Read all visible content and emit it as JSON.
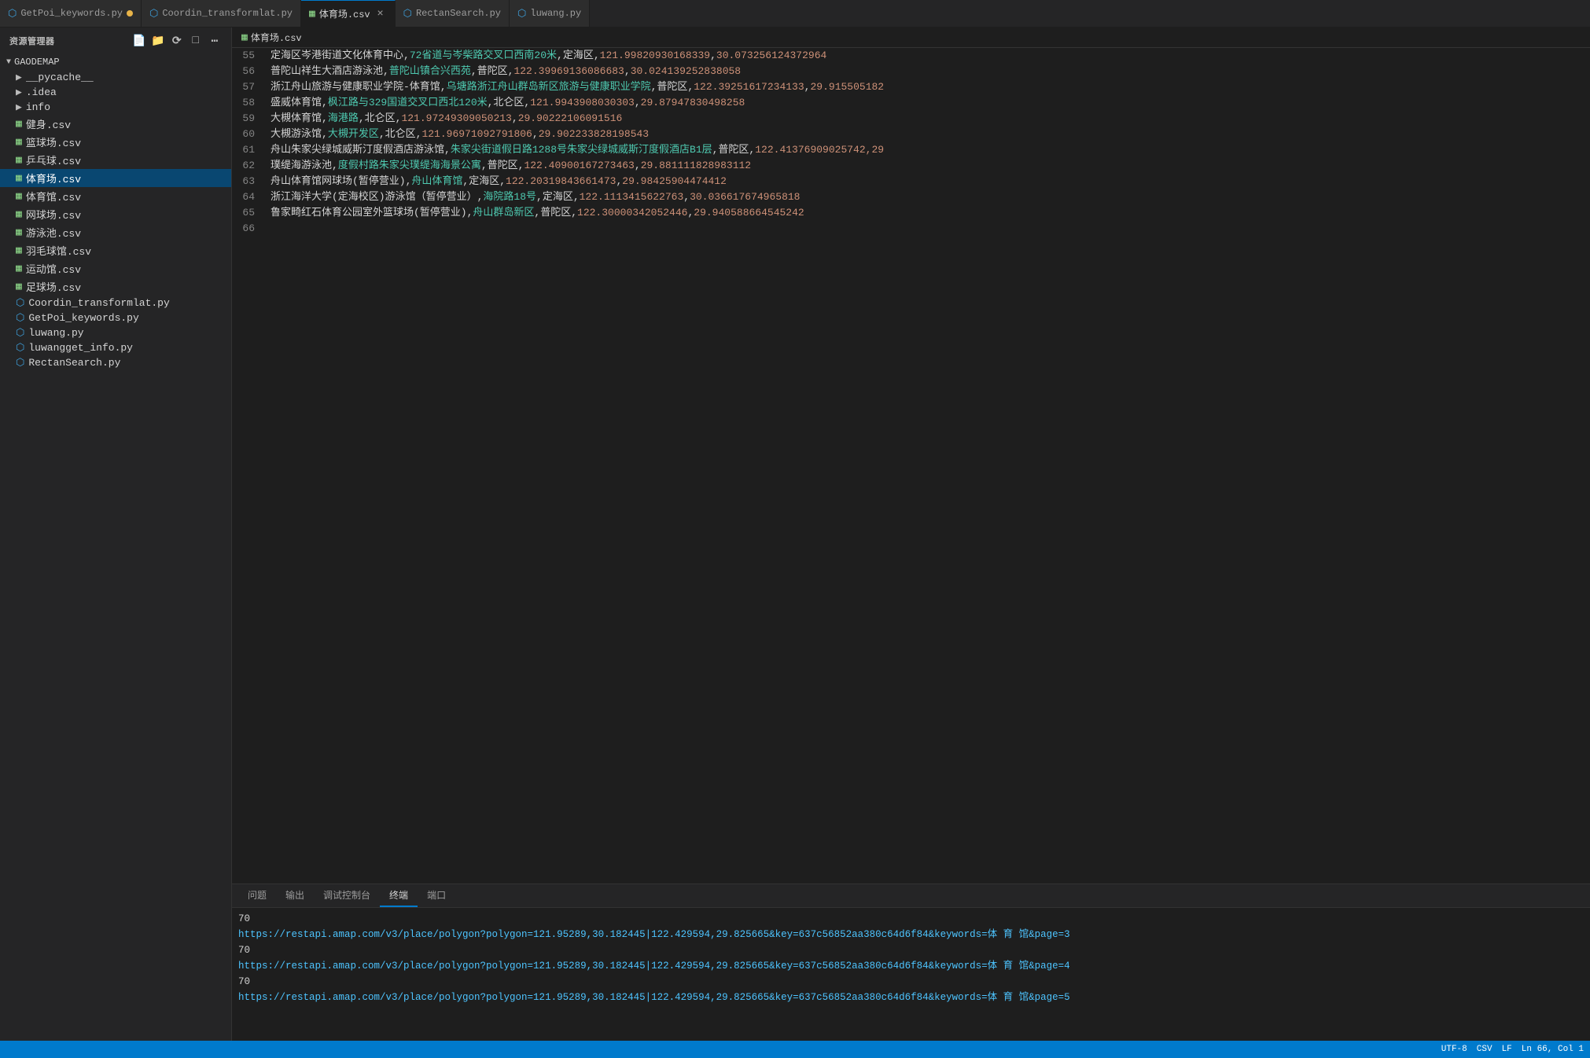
{
  "app": {
    "title": "资源管理器",
    "more_icon": "⋯"
  },
  "tabs": [
    {
      "id": "tab-getpoi",
      "label": "GetPoi_keywords.py",
      "icon_type": "py",
      "active": false,
      "modified": true,
      "closable": false
    },
    {
      "id": "tab-coordin",
      "label": "Coordin_transformlat.py",
      "icon_type": "py",
      "active": false,
      "modified": false,
      "closable": false
    },
    {
      "id": "tab-tiyuchang",
      "label": "体育场.csv",
      "icon_type": "csv",
      "active": true,
      "modified": false,
      "closable": true
    },
    {
      "id": "tab-rectansearch",
      "label": "RectanSearch.py",
      "icon_type": "py",
      "active": false,
      "modified": false,
      "closable": false
    },
    {
      "id": "tab-luwang",
      "label": "luwang.py",
      "icon_type": "py",
      "active": false,
      "modified": false,
      "closable": false
    }
  ],
  "breadcrumb": {
    "icon_type": "csv",
    "path": "体育场.csv"
  },
  "sidebar": {
    "title": "资源管理器",
    "root": "GAODEMAP",
    "items": [
      {
        "id": "pycache",
        "label": "__pycache__",
        "type": "folder",
        "indent": 1
      },
      {
        "id": "idea",
        "label": ".idea",
        "type": "folder",
        "indent": 1
      },
      {
        "id": "info",
        "label": "info",
        "type": "folder",
        "indent": 1
      },
      {
        "id": "jianshen",
        "label": "健身.csv",
        "type": "csv",
        "indent": 1,
        "active": false
      },
      {
        "id": "lanqiuchang",
        "label": "篮球场.csv",
        "type": "csv",
        "indent": 1,
        "active": false
      },
      {
        "id": "pingpangqiu",
        "label": "乒乓球.csv",
        "type": "csv",
        "indent": 1,
        "active": false
      },
      {
        "id": "tiyuchang",
        "label": "体育场.csv",
        "type": "csv",
        "indent": 1,
        "active": true
      },
      {
        "id": "tiyuguan",
        "label": "体育馆.csv",
        "type": "csv",
        "indent": 1,
        "active": false
      },
      {
        "id": "wangqiuchang",
        "label": "网球场.csv",
        "type": "csv",
        "indent": 1,
        "active": false
      },
      {
        "id": "youyongchi",
        "label": "游泳池.csv",
        "type": "csv",
        "indent": 1,
        "active": false
      },
      {
        "id": "yumaoqiuguan",
        "label": "羽毛球馆.csv",
        "type": "csv",
        "indent": 1,
        "active": false
      },
      {
        "id": "yundongguan",
        "label": "运动馆.csv",
        "type": "csv",
        "indent": 1,
        "active": false
      },
      {
        "id": "zuqiuchang",
        "label": "足球场.csv",
        "type": "csv",
        "indent": 1,
        "active": false
      },
      {
        "id": "coordin",
        "label": "Coordin_transformlat.py",
        "type": "py",
        "indent": 1,
        "active": false
      },
      {
        "id": "getpoi",
        "label": "GetPoi_keywords.py",
        "type": "py",
        "indent": 1,
        "active": false
      },
      {
        "id": "luwang",
        "label": "luwang.py",
        "type": "py",
        "indent": 1,
        "active": false
      },
      {
        "id": "luwangget",
        "label": "luwangget_info.py",
        "type": "py",
        "indent": 1,
        "active": false
      },
      {
        "id": "rectansearch",
        "label": "RectanSearch.py",
        "type": "py",
        "indent": 1,
        "active": false
      }
    ]
  },
  "code_lines": [
    {
      "num": 55,
      "parts": [
        {
          "text": "定海区岑港街道文化体育中心,",
          "color": "white"
        },
        {
          "text": "72省道与岑柴路交叉口西南20米",
          "color": "green"
        },
        {
          "text": ",定海区,",
          "color": "white"
        },
        {
          "text": "121.99820930168339",
          "color": "orange"
        },
        {
          "text": ",",
          "color": "white"
        },
        {
          "text": "30.073256124372964",
          "color": "orange"
        }
      ]
    },
    {
      "num": 56,
      "parts": [
        {
          "text": "普陀山祥生大酒店游泳池,",
          "color": "white"
        },
        {
          "text": "普陀山镇合兴西苑",
          "color": "green"
        },
        {
          "text": ",普陀区,",
          "color": "white"
        },
        {
          "text": "122.39969136086683",
          "color": "orange"
        },
        {
          "text": ",",
          "color": "white"
        },
        {
          "text": "30.024139252838058",
          "color": "orange"
        }
      ]
    },
    {
      "num": 57,
      "parts": [
        {
          "text": "浙江舟山旅游与健康职业学院-体育馆,",
          "color": "white"
        },
        {
          "text": "乌塘路浙江舟山群岛新区旅游与健康职业学院",
          "color": "green"
        },
        {
          "text": ",普陀区,",
          "color": "white"
        },
        {
          "text": "122.39251617234133",
          "color": "orange"
        },
        {
          "text": ",",
          "color": "white"
        },
        {
          "text": "29.915505182",
          "color": "orange"
        }
      ]
    },
    {
      "num": 58,
      "parts": [
        {
          "text": "盛威体育馆,",
          "color": "white"
        },
        {
          "text": "枫江路与329国道交叉口西北120米",
          "color": "green"
        },
        {
          "text": ",北仑区,",
          "color": "white"
        },
        {
          "text": "121.9943908030303",
          "color": "orange"
        },
        {
          "text": ",",
          "color": "white"
        },
        {
          "text": "29.87947830498258",
          "color": "orange"
        }
      ]
    },
    {
      "num": 59,
      "parts": [
        {
          "text": "大槻体育馆,",
          "color": "white"
        },
        {
          "text": "海港路",
          "color": "green"
        },
        {
          "text": ",北仑区,",
          "color": "white"
        },
        {
          "text": "121.97249309050213",
          "color": "orange"
        },
        {
          "text": ",",
          "color": "white"
        },
        {
          "text": "29.90222106091516",
          "color": "orange"
        }
      ]
    },
    {
      "num": 60,
      "parts": [
        {
          "text": "大槻游泳馆,",
          "color": "white"
        },
        {
          "text": "大槻开发区",
          "color": "green"
        },
        {
          "text": ",北仑区,",
          "color": "white"
        },
        {
          "text": "121.96971092791806",
          "color": "orange"
        },
        {
          "text": ",",
          "color": "white"
        },
        {
          "text": "29.902233828198543",
          "color": "orange"
        }
      ]
    },
    {
      "num": 61,
      "parts": [
        {
          "text": "舟山朱家尖绿城威斯汀度假酒店游泳馆,",
          "color": "white"
        },
        {
          "text": "朱家尖街道假日路1288号朱家尖绿城威斯汀度假酒店B1层",
          "color": "green"
        },
        {
          "text": ",普陀区,",
          "color": "white"
        },
        {
          "text": "122.41376909025742",
          "color": "orange"
        },
        {
          "text": ",29",
          "color": "orange"
        }
      ]
    },
    {
      "num": 62,
      "parts": [
        {
          "text": "璞缇海游泳池,",
          "color": "white"
        },
        {
          "text": "度假村路朱家尖璞缇海海景公寓",
          "color": "green"
        },
        {
          "text": ",普陀区,",
          "color": "white"
        },
        {
          "text": "122.40900167273463",
          "color": "orange"
        },
        {
          "text": ",",
          "color": "white"
        },
        {
          "text": "29.881111828983112",
          "color": "orange"
        }
      ]
    },
    {
      "num": 63,
      "parts": [
        {
          "text": "舟山体育馆网球场(暂停营业),",
          "color": "white"
        },
        {
          "text": "舟山体育馆",
          "color": "green"
        },
        {
          "text": ",定海区,",
          "color": "white"
        },
        {
          "text": "122.20319843661473",
          "color": "orange"
        },
        {
          "text": ",",
          "color": "white"
        },
        {
          "text": "29.98425904474412",
          "color": "orange"
        }
      ]
    },
    {
      "num": 64,
      "parts": [
        {
          "text": "浙江海洋大学(定海校区)游泳馆（暂停营业）,",
          "color": "white"
        },
        {
          "text": "海院路18号",
          "color": "green"
        },
        {
          "text": ",定海区,",
          "color": "white"
        },
        {
          "text": "122.1113415622763",
          "color": "orange"
        },
        {
          "text": ",",
          "color": "white"
        },
        {
          "text": "30.036617674965818",
          "color": "orange"
        }
      ]
    },
    {
      "num": 65,
      "parts": [
        {
          "text": "鲁家畸红石体育公园室外篮球场(暂停营业),",
          "color": "white"
        },
        {
          "text": "舟山群岛新区",
          "color": "green"
        },
        {
          "text": ",普陀区,",
          "color": "white"
        },
        {
          "text": "122.30000342052446",
          "color": "orange"
        },
        {
          "text": ",",
          "color": "white"
        },
        {
          "text": "29.940588664545242",
          "color": "orange"
        }
      ]
    },
    {
      "num": 66,
      "parts": []
    }
  ],
  "panel": {
    "tabs": [
      {
        "id": "wenti",
        "label": "问题",
        "active": false
      },
      {
        "id": "shuchu",
        "label": "输出",
        "active": false
      },
      {
        "id": "tiaoshi",
        "label": "调试控制台",
        "active": false
      },
      {
        "id": "zhongduan",
        "label": "终端",
        "active": true
      },
      {
        "id": "duankou",
        "label": "端口",
        "active": false
      }
    ],
    "terminal_lines": [
      {
        "text": "70",
        "type": "text"
      },
      {
        "text": "https://restapi.amap.com/v3/place/polygon?polygon=121.95289,30.182445|122.429594,29.825665&key=637c56852aa380c64d6f84&keywords=体 育 馆&page=3",
        "type": "url"
      },
      {
        "text": "70",
        "type": "text"
      },
      {
        "text": "https://restapi.amap.com/v3/place/polygon?polygon=121.95289,30.182445|122.429594,29.825665&key=637c56852aa380c64d6f84&keywords=体 育 馆&page=4",
        "type": "url"
      },
      {
        "text": "70",
        "type": "text"
      },
      {
        "text": "https://restapi.amap.com/v3/place/polygon?polygon=121.95289,30.182445|122.429594,29.825665&key=637c56852aa380c64d6f84&keywords=体 育 馆&page=5",
        "type": "url"
      }
    ]
  },
  "status_bar": {
    "items": [
      "UTF-8",
      "CSV",
      "LF",
      "Ln 66, Col 1"
    ]
  }
}
